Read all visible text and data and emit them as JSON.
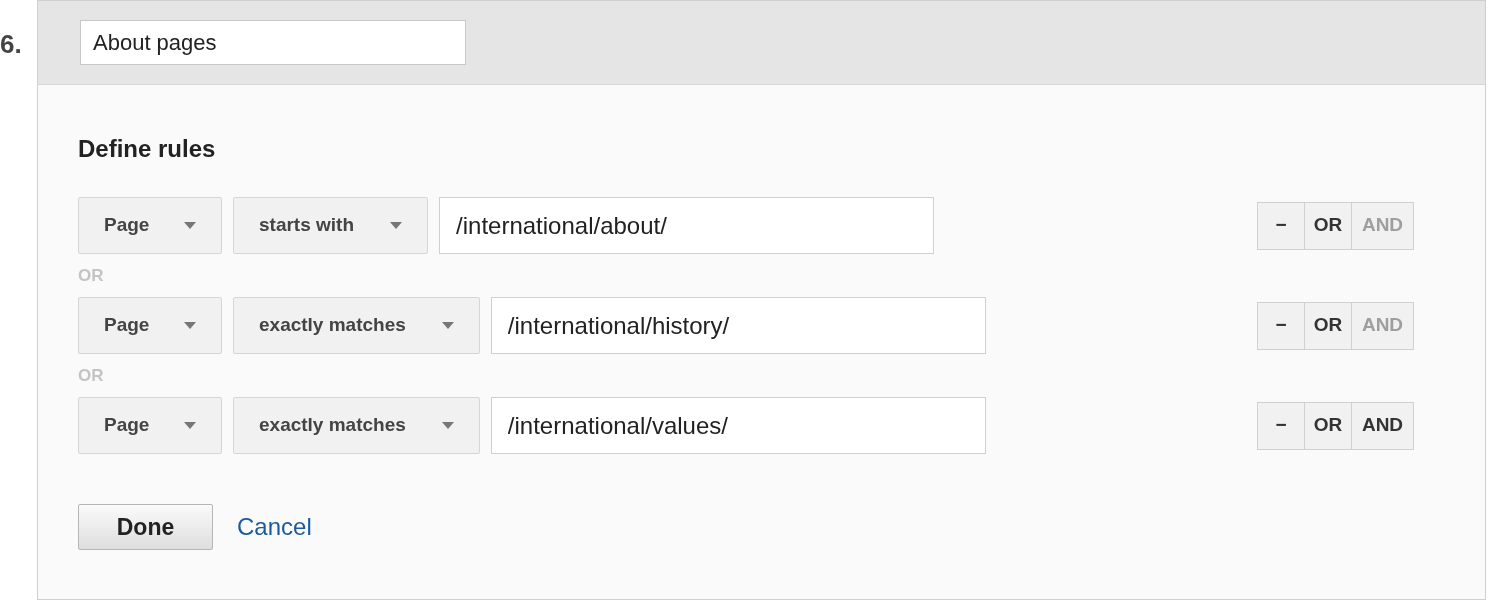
{
  "section_number": "6.",
  "name_field": {
    "value": "About pages"
  },
  "heading": "Define rules",
  "rules": [
    {
      "dimension": "Page",
      "condition": "starts with",
      "value": "/international/about/",
      "joiner": "OR",
      "actions": [
        {
          "label": "−",
          "disabled": false
        },
        {
          "label": "OR",
          "disabled": false
        },
        {
          "label": "AND",
          "disabled": true
        }
      ]
    },
    {
      "dimension": "Page",
      "condition": "exactly matches",
      "value": "/international/history/",
      "joiner": "OR",
      "actions": [
        {
          "label": "−",
          "disabled": false
        },
        {
          "label": "OR",
          "disabled": false
        },
        {
          "label": "AND",
          "disabled": true
        }
      ]
    },
    {
      "dimension": "Page",
      "condition": "exactly matches",
      "value": "/international/values/",
      "actions": [
        {
          "label": "−",
          "disabled": false
        },
        {
          "label": "OR",
          "disabled": false
        },
        {
          "label": "AND",
          "disabled": false
        }
      ]
    }
  ],
  "done_button": "Done",
  "cancel_link": "Cancel"
}
